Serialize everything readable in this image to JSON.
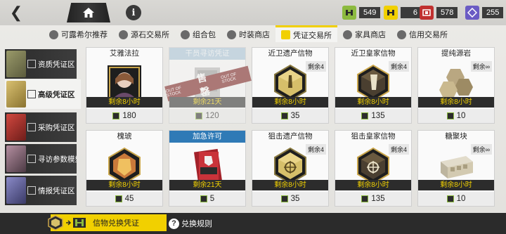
{
  "header": {
    "home_icon": "home-icon",
    "back_icon": "back-chevron-icon",
    "info_icon": "info-icon",
    "currencies": [
      {
        "icon": "green-voucher-icon",
        "color": "#8cba3f",
        "value": "549"
      },
      {
        "icon": "yellow-voucher-icon",
        "color": "#f1d000",
        "value": "6"
      },
      {
        "icon": "red-voucher-icon",
        "color": "#c0302f",
        "value": "578"
      },
      {
        "icon": "purple-voucher-icon",
        "color": "#6a5bc4",
        "value": "255"
      }
    ]
  },
  "shop_tabs": [
    {
      "label": "可露希尔推荐",
      "active": false
    },
    {
      "label": "源石交易所",
      "active": false
    },
    {
      "label": "组合包",
      "active": false
    },
    {
      "label": "时装商店",
      "active": false
    },
    {
      "label": "凭证交易所",
      "active": true
    },
    {
      "label": "家具商店",
      "active": false
    },
    {
      "label": "信用交易所",
      "active": false
    }
  ],
  "categories": [
    {
      "label": "资质凭证区",
      "active": false,
      "color": "#7c7c5a"
    },
    {
      "label": "高级凭证区",
      "active": true,
      "color": "#b59b4a"
    },
    {
      "label": "采购凭证区",
      "active": false,
      "color": "#a8322c"
    },
    {
      "label": "寻访参数模型",
      "active": false,
      "color": "#8a6f7a"
    },
    {
      "label": "情报凭证区",
      "active": false,
      "color": "#5a5a8a"
    }
  ],
  "items": [
    {
      "title": "艾雅法拉",
      "title_style": "plain",
      "remain": "",
      "stock": "剩余8小时",
      "price": "180",
      "art": "operator",
      "soldout": false
    },
    {
      "title": "干员寻访凭证",
      "title_style": "paleblue",
      "remain": "",
      "stock": "剩余21天",
      "price": "120",
      "art": "ticket",
      "soldout": true
    },
    {
      "title": "近卫遗产信物",
      "title_style": "plain",
      "remain": "剩余4",
      "stock": "剩余8小时",
      "price": "35",
      "art": "gold-token",
      "soldout": false
    },
    {
      "title": "近卫皇家信物",
      "title_style": "plain",
      "remain": "剩余4",
      "stock": "剩余8小时",
      "price": "135",
      "art": "dark-token",
      "soldout": false
    },
    {
      "title": "提纯源岩",
      "title_style": "plain",
      "remain": "剩余∞",
      "stock": "剩余8小时",
      "price": "10",
      "art": "rock",
      "soldout": false
    },
    {
      "title": "槐琥",
      "title_style": "plain",
      "remain": "",
      "stock": "剩余8小时",
      "price": "45",
      "art": "operator-gold",
      "soldout": false
    },
    {
      "title": "加急许可",
      "title_style": "blue",
      "remain": "",
      "stock": "剩余21天",
      "price": "5",
      "art": "permit",
      "soldout": false
    },
    {
      "title": "狙击遗产信物",
      "title_style": "plain",
      "remain": "剩余4",
      "stock": "剩余8小时",
      "price": "35",
      "art": "gold-token",
      "soldout": false
    },
    {
      "title": "狙击皇家信物",
      "title_style": "plain",
      "remain": "剩余4",
      "stock": "剩余8小时",
      "price": "135",
      "art": "dark-token",
      "soldout": false
    },
    {
      "title": "糖聚块",
      "title_style": "plain",
      "remain": "剩余∞",
      "stock": "剩余8小时",
      "price": "10",
      "art": "sugar",
      "soldout": false
    }
  ],
  "soldout_text": {
    "left": "OUT OF STOCK",
    "center": "售罄",
    "right": "OUT OF STOCK"
  },
  "footer": {
    "exchange_label": "信物兑换凭证",
    "rules_label": "兑换规则",
    "rules_icon": "question-icon"
  }
}
